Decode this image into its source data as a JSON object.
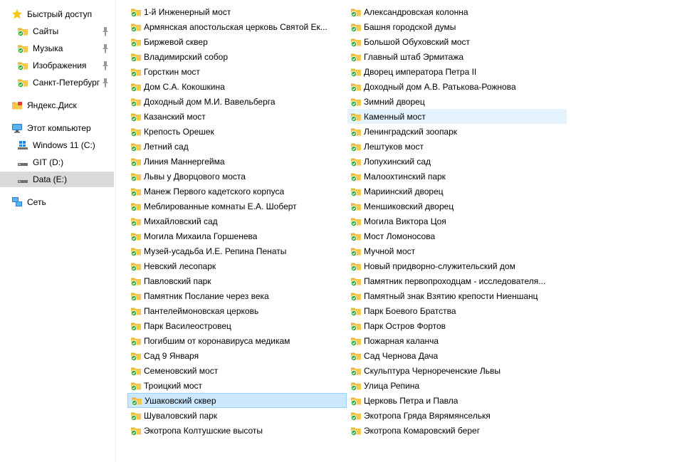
{
  "nav": {
    "items": [
      {
        "label": "Быстрый доступ",
        "icon": "star-icon"
      },
      {
        "label": "Сайты",
        "icon": "synced-folder-icon",
        "pinned": true
      },
      {
        "label": "Музыка",
        "icon": "synced-folder-icon",
        "pinned": true
      },
      {
        "label": "Изображения",
        "icon": "synced-folder-icon",
        "pinned": true
      },
      {
        "label": "Санкт-Петербург",
        "icon": "synced-folder-icon",
        "pinned": true
      },
      {
        "label": "Яндекс.Диск",
        "icon": "yandex-disk-icon"
      },
      {
        "label": "Этот компьютер",
        "icon": "computer-icon"
      },
      {
        "label": "Windows 11 (C:)",
        "icon": "windows-drive-icon"
      },
      {
        "label": "GIT (D:)",
        "icon": "drive-icon"
      },
      {
        "label": "Data (E:)",
        "icon": "drive-icon",
        "selected": true
      },
      {
        "label": "Сеть",
        "icon": "network-icon"
      }
    ]
  },
  "files": {
    "column1": [
      "1-й Инженерный мост",
      "Армянская апостольская церковь Святой Ек...",
      "Биржевой сквер",
      "Владимирский собор",
      "Горсткин мост",
      "Дом С.А. Кокошкина",
      "Доходный дом М.И. Вавельберга",
      "Казанский мост",
      "Крепость Орешек",
      "Летний сад",
      "Линия Маннергейма",
      "Львы у Дворцового моста",
      "Манеж Первого кадетского корпуса",
      "Меблированные комнаты Е.А. Шоберт",
      "Михайловский сад",
      "Могила Михаила Горшенева",
      "Музей-усадьба И.Е. Репина Пенаты",
      "Невский лесопарк",
      "Павловский парк",
      "Памятник Послание через века",
      "Пантелеймоновская церковь",
      "Парк Василеостровец",
      "Погибшим от коронавируса медикам",
      "Сад 9 Января",
      "Семеновский мост",
      "Троицкий мост",
      "Ушаковский сквер",
      "Шуваловский парк",
      "Экотропа Колтушские высоты"
    ],
    "column2": [
      "Александровская колонна",
      "Башня городской думы",
      "Большой Обуховский мост",
      "Главный штаб Эрмитажа",
      "Дворец императора Петра II",
      "Доходный дом А.В. Ратькова-Рожнова",
      "Зимний дворец",
      "Каменный мост",
      "Ленинградский зоопарк",
      "Лештуков мост",
      "Лопухинский сад",
      "Малоохтинский парк",
      "Мариинский дворец",
      "Меншиковский дворец",
      "Могила Виктора Цоя",
      "Мост Ломоносова",
      "Мучной мост",
      "Новый придворно-служительский дом",
      "Памятник первопроходцам - исследователя...",
      "Памятный знак Взятию крепости Ниеншанц",
      "Парк Боевого Братства",
      "Парк Остров Фортов",
      "Пожарная каланча",
      "Сад Чернова Дача",
      "Скульптура Чернореченские Львы",
      "Улица Репина",
      "Церковь Петра и Павла",
      "Экотропа Гряда Вярямянселькя",
      "Экотропа Комаровский берег"
    ],
    "selected": "Ушаковский сквер",
    "hovered": "Каменный мост",
    "item_icon": "synced-folder-icon"
  },
  "colors": {
    "folder": "#f7c94b",
    "synced_check": "#2eaa3c",
    "selection_bg": "#cce8ff",
    "hover_bg": "#e5f3ff",
    "nav_selected_bg": "#d9d9d9"
  }
}
